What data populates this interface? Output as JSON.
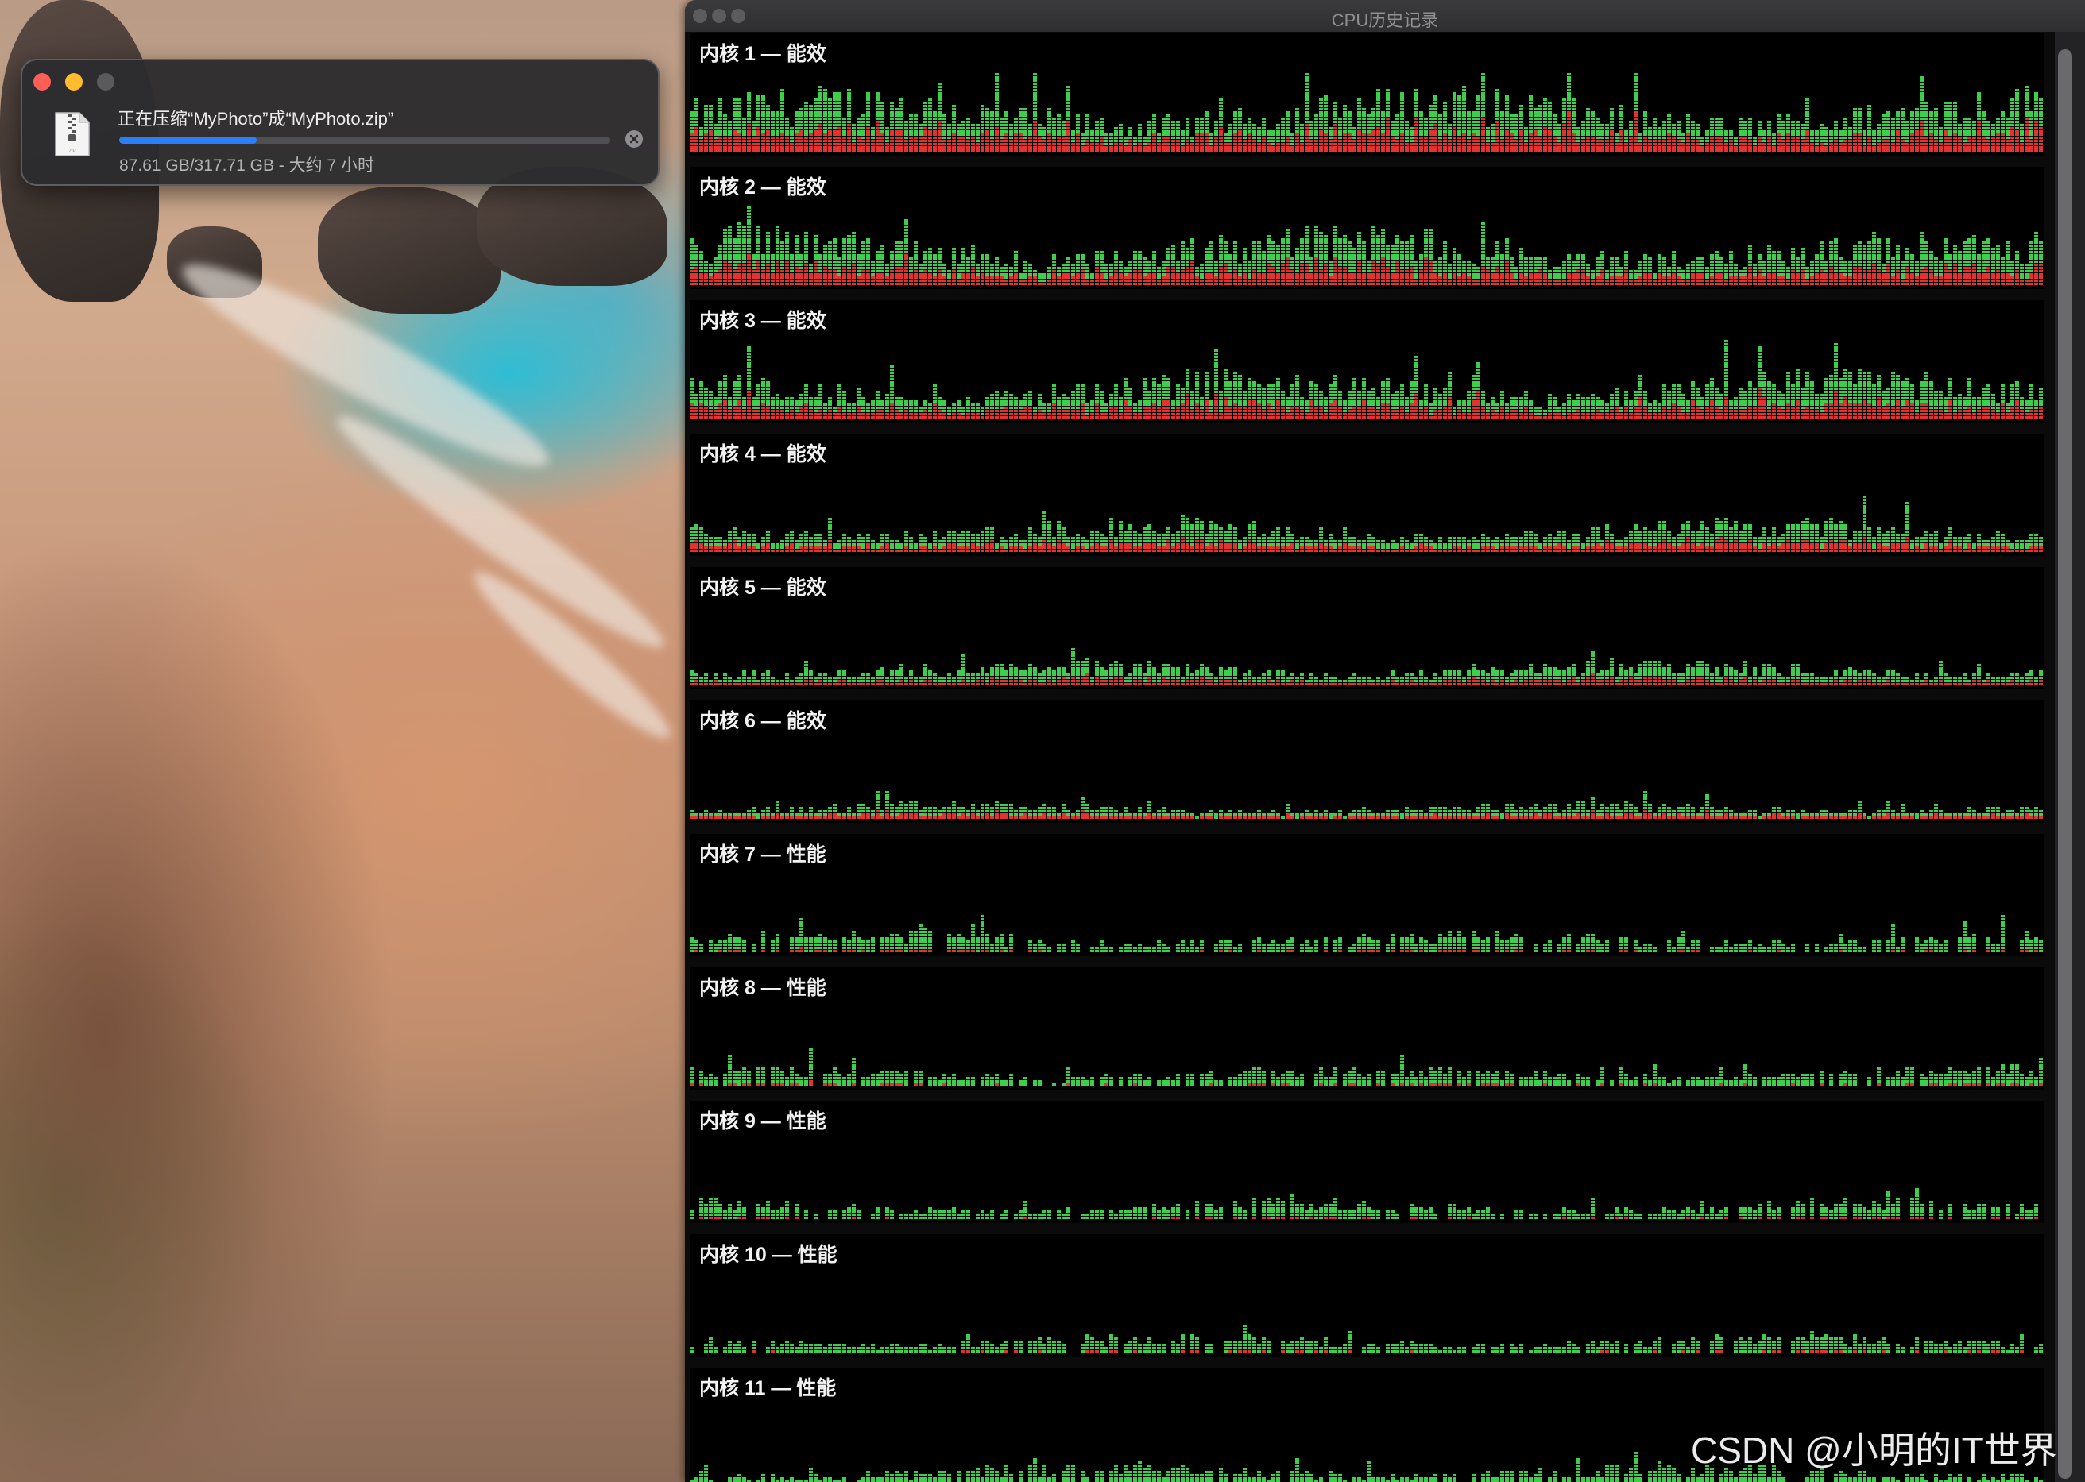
{
  "dialog": {
    "title": "正在压缩“MyPhoto”成“MyPhoto.zip”",
    "status": "87.61 GB/317.71 GB - 大约 7 小时",
    "progress": 0.28,
    "progress_color": "#2d7ff9",
    "file_icon": "zip-file-icon",
    "cancel_icon": "cancel-icon",
    "traffic_lights": {
      "close": "#ff5f57",
      "minimize": "#febc2e",
      "zoom": "#5a5a5c"
    }
  },
  "cpu_window": {
    "title": "CPU历史记录",
    "colors": {
      "user": "#3ecf4a",
      "system": "#e5322e",
      "background": "#000000"
    },
    "cores": [
      {
        "label": "内核 1 — 能效",
        "level": 0.44,
        "sys": 0.42
      },
      {
        "label": "内核 2 — 能效",
        "level": 0.4,
        "sys": 0.4
      },
      {
        "label": "内核 3 — 能效",
        "level": 0.33,
        "sys": 0.38
      },
      {
        "label": "内核 4 — 能效",
        "level": 0.24,
        "sys": 0.36
      },
      {
        "label": "内核 5 — 能效",
        "level": 0.18,
        "sys": 0.34
      },
      {
        "label": "内核 6 — 能效",
        "level": 0.12,
        "sys": 0.33
      },
      {
        "label": "内核 7 — 性能",
        "level": 0.15,
        "sys": 0.12
      },
      {
        "label": "内核 8 — 性能",
        "level": 0.14,
        "sys": 0.12
      },
      {
        "label": "内核 9 — 性能",
        "level": 0.14,
        "sys": 0.12
      },
      {
        "label": "内核 10 — 性能",
        "level": 0.13,
        "sys": 0.12
      },
      {
        "label": "内核 11 — 性能",
        "level": 0.16,
        "sys": 0.12
      }
    ]
  },
  "watermark": "CSDN @小明的IT世界"
}
